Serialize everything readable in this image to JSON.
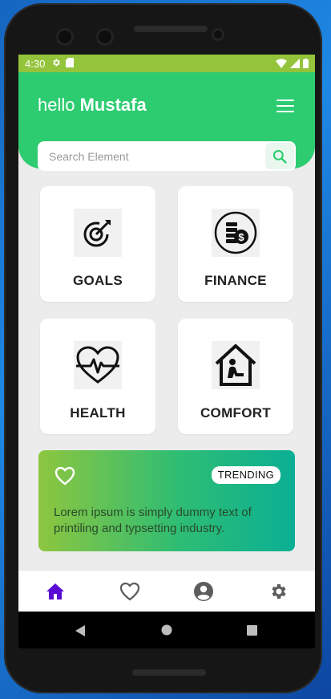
{
  "status_bar": {
    "time": "4:30"
  },
  "header": {
    "greeting_hello": "hello",
    "greeting_name": "Mustafa"
  },
  "search": {
    "placeholder": "Search Element"
  },
  "categories": [
    {
      "label": "GOALS",
      "icon": "target-icon"
    },
    {
      "label": "FINANCE",
      "icon": "coins-dollar-icon"
    },
    {
      "label": "HEALTH",
      "icon": "heartbeat-icon"
    },
    {
      "label": "COMFORT",
      "icon": "house-person-icon"
    }
  ],
  "trending": {
    "badge": "TRENDING",
    "description": "Lorem ipsum is simply dummy text of printiling and typsetting industry."
  },
  "bottom_nav": [
    {
      "icon": "home-icon",
      "active": true
    },
    {
      "icon": "heart-icon",
      "active": false
    },
    {
      "icon": "account-icon",
      "active": false
    },
    {
      "icon": "gear-icon",
      "active": false
    }
  ],
  "colors": {
    "header": "#2ecc71",
    "status_bar": "#94c43c",
    "active_nav": "#5b0bd6",
    "inactive_nav": "#5c5c5c"
  }
}
